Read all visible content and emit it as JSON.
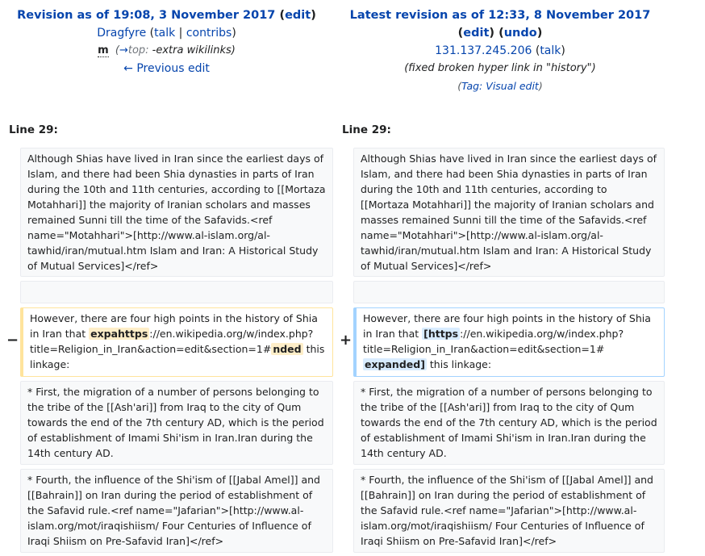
{
  "left_header": {
    "title_prefix": "Revision as of 19:08, 3 November 2017",
    "edit_label": "edit",
    "user": "Dragfyre",
    "talk_label": "talk",
    "contribs_label": "contribs",
    "minor_flag": "m",
    "arrow": "→",
    "section": "top:",
    "summary": "-extra wikilinks)",
    "prev_edit": "← Previous edit"
  },
  "right_header": {
    "title": "Latest revision as of 12:33, 8 November 2017",
    "edit_label": "edit",
    "undo_label": "undo",
    "user_ip": "131.137.245.206",
    "talk_label": "talk",
    "summary": "(fixed broken hyper link in \"history\")",
    "tag_label": "Tag:",
    "tag_value": "Visual edit"
  },
  "line_left": "Line 29:",
  "line_right": "Line 29:",
  "markers": {
    "minus": "−",
    "plus": "+"
  },
  "context1": "Although Shias have lived in Iran since the earliest days of Islam, and there had been Shia dynasties in parts of Iran during the 10th and 11th centuries, according to [[Mortaza Motahhari]] the majority of Iranian scholars and masses remained Sunni till the time of the Safavids.<ref name=\"Motahhari\">[http://www.al-islam.org/al-tawhid/iran/mutual.htm Islam and Iran: A Historical Study of Mutual Services]</ref>",
  "changed_left": {
    "pre": "However, there are four high points in the history of Shia in Iran that ",
    "del1": "expahttps",
    "mid": "://en.wikipedia.org/w/index.php?title=Religion_in_Iran&action=edit&section=1#",
    "del2": "nded",
    "post": " this linkage:"
  },
  "changed_right": {
    "pre": "However, there are four high points in the history of Shia in Iran that ",
    "add1": "[https",
    "mid": "://en.wikipedia.org/w/index.php?title=Religion_in_Iran&action=edit&section=1# ",
    "add2": "expanded]",
    "post": " this linkage:"
  },
  "context2": "* First, the migration of a number of persons belonging to the tribe of the [[Ash'ari]] from Iraq to the city of Qum towards the end of the 7th century AD, which is the period of establishment of Imami Shi'ism in Iran.Iran during the 14th century AD.",
  "context3": "* Fourth, the influence of the Shi'ism of [[Jabal Amel]] and [[Bahrain]] on Iran during the period of establishment of the Safavid rule.<ref name=\"Jafarian\">[http://www.al-islam.org/mot/iraqishiism/ Four Centuries of Influence of Iraqi Shiism on Pre-Safavid Iran]</ref>",
  "colors": {
    "link": "#0645ad",
    "deleted_border": "#ffe49c",
    "added_border": "#a3d3ff",
    "deleted_highlight": "#feeec8",
    "added_highlight": "#d8ecff"
  }
}
